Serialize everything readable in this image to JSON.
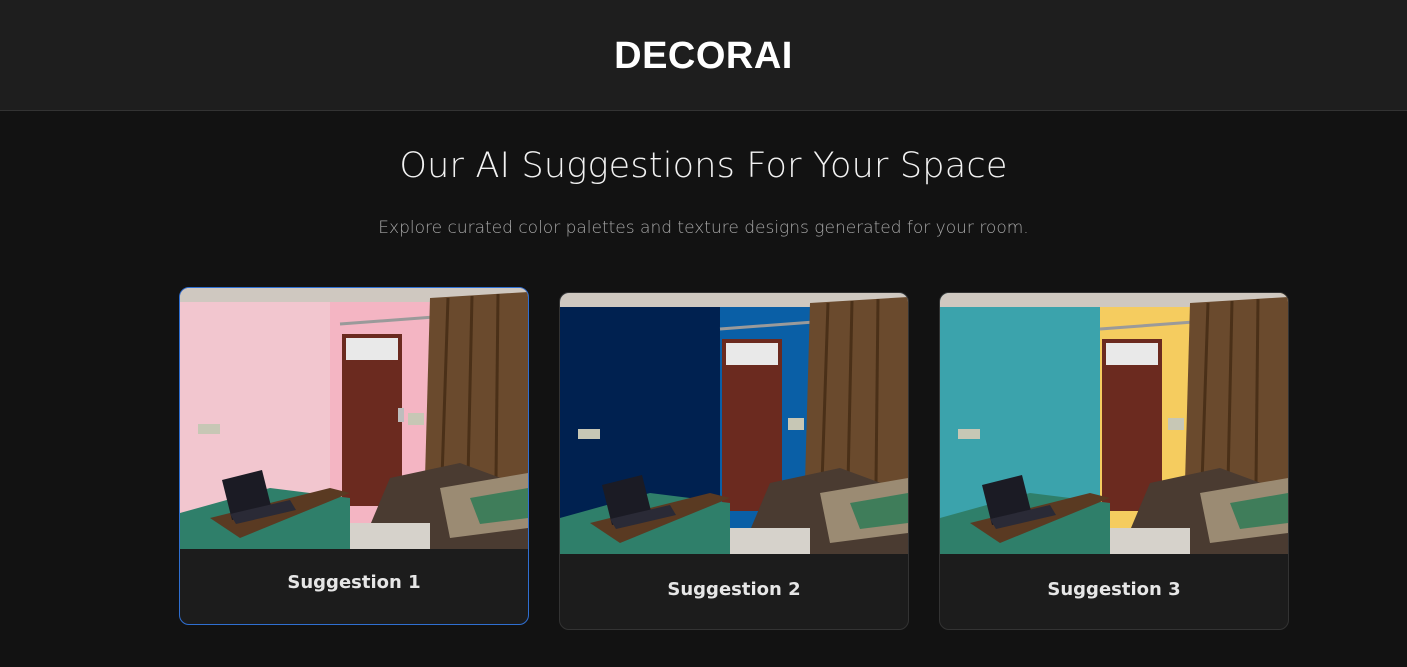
{
  "header": {
    "brand": "DECORAI"
  },
  "main": {
    "title": "Our AI Suggestions For Your Space",
    "subtitle": "Explore curated color palettes and texture designs generated for your room."
  },
  "suggestions": [
    {
      "label": "Suggestion 1",
      "wall_left": "#f2c6cf",
      "wall_right": "#f4b5c3",
      "selected": true
    },
    {
      "label": "Suggestion 2",
      "wall_left": "#002150",
      "wall_right": "#0a5fa6",
      "selected": false
    },
    {
      "label": "Suggestion 3",
      "wall_left": "#3ba3ac",
      "wall_right": "#f5cc5f",
      "selected": false
    }
  ],
  "colors": {
    "background": "#121212",
    "header": "#1e1e1e",
    "card": "#1c1c1c",
    "accent": "#2f6fd1"
  }
}
